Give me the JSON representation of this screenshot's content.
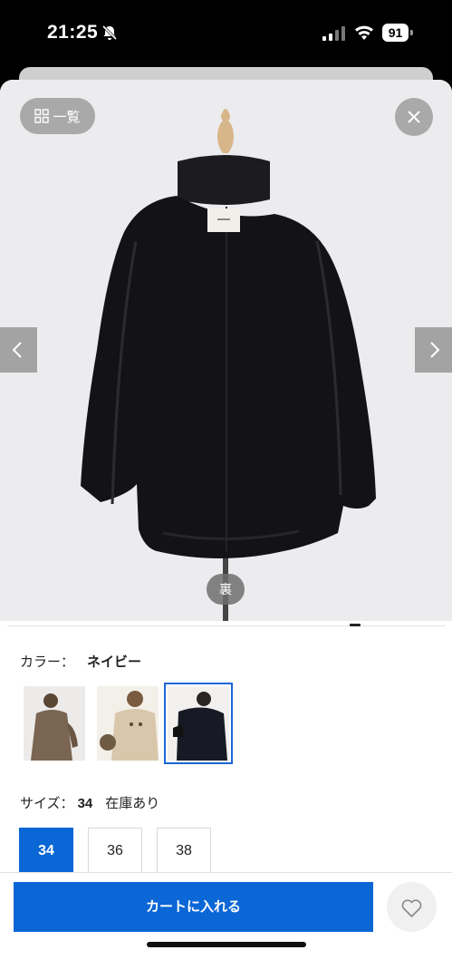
{
  "status": {
    "time": "21:25",
    "battery": "91"
  },
  "viewer": {
    "list_label": "一覧",
    "back_label": "裏",
    "image_alt": "coat back view"
  },
  "color": {
    "label": "カラー：",
    "value": "ネイビー",
    "swatches": [
      "brown",
      "beige",
      "navy"
    ],
    "selected_index": 2
  },
  "size": {
    "label": "サイズ：",
    "value": "34",
    "stock": "在庫あり",
    "options": [
      "34",
      "36",
      "38"
    ],
    "selected": "34"
  },
  "cart": {
    "label": "カートに入れる"
  },
  "colors": {
    "accent": "#0b66d6"
  }
}
